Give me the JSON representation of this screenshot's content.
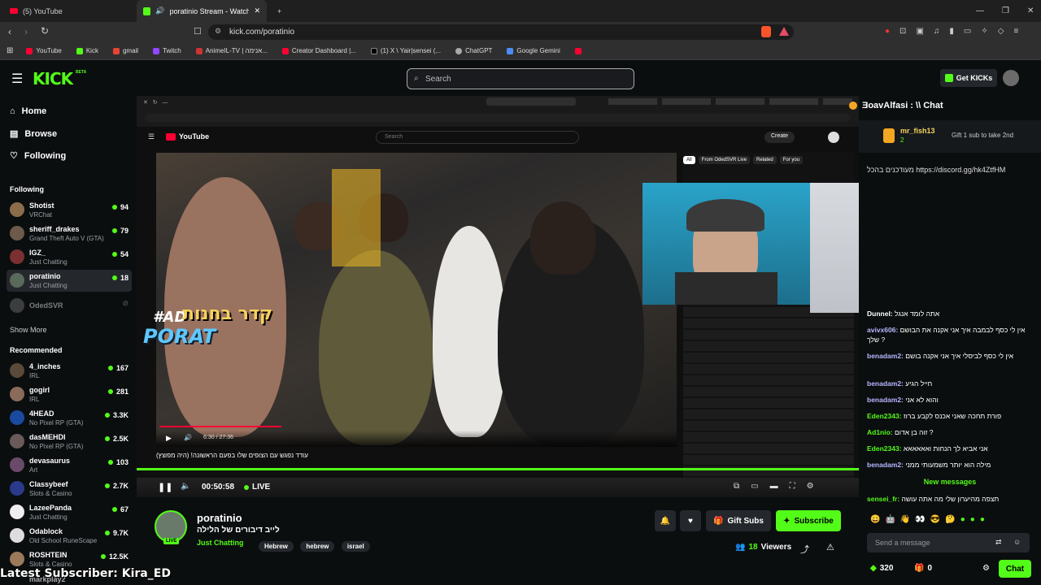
{
  "browser": {
    "tabs": [
      {
        "title": "(5) YouTube",
        "active": false
      },
      {
        "title": "poratinio Stream - Watch Live",
        "active": true
      }
    ],
    "new_tab": "+",
    "url": "kick.com/poratinio",
    "bookmarks": [
      "YouTube",
      "Kick",
      "gmail",
      "Twitch",
      "AnimeIL-TV | אנימה...",
      "Creator Dashboard |...",
      "(1) X \\ Yair|sensei (...",
      "ChatGPT",
      "Google Gemini"
    ]
  },
  "kick": {
    "logo": "KICK",
    "beta": "BETA",
    "search_placeholder": "Search",
    "get_kicks": "Get KICKs"
  },
  "sidebar": {
    "nav": [
      "Home",
      "Browse",
      "Following"
    ],
    "following_header": "Following",
    "following": [
      {
        "name": "Shotist",
        "game": "VRChat",
        "viewers": "94"
      },
      {
        "name": "sheriff_drakes",
        "game": "Grand Theft Auto V (GTA)",
        "viewers": "79"
      },
      {
        "name": "IGZ_",
        "game": "Just Chatting",
        "viewers": "54"
      },
      {
        "name": "poratinio",
        "game": "Just Chatting",
        "viewers": "18"
      },
      {
        "name": "OdedSVR",
        "game": "",
        "viewers": ""
      }
    ],
    "show_more": "Show More",
    "recommended_header": "Recommended",
    "recommended": [
      {
        "name": "4_inches",
        "game": "IRL",
        "viewers": "167"
      },
      {
        "name": "gogirl",
        "game": "IRL",
        "viewers": "281"
      },
      {
        "name": "4HEAD",
        "game": "No Pixel RP (GTA)",
        "viewers": "3.3K"
      },
      {
        "name": "dasMEHDI",
        "game": "No Pixel RP (GTA)",
        "viewers": "2.5K"
      },
      {
        "name": "devasaurus",
        "game": "Art",
        "viewers": "103"
      },
      {
        "name": "Classybeef",
        "game": "Slots & Casino",
        "viewers": "2.7K"
      },
      {
        "name": "LazeePanda",
        "game": "Just Chatting",
        "viewers": "67"
      },
      {
        "name": "Odablock",
        "game": "Old School RuneScape",
        "viewers": "9.7K"
      },
      {
        "name": "ROSHTEIN",
        "game": "Slots & Casino",
        "viewers": "12.5K"
      }
    ]
  },
  "stream": {
    "inner_search": "Search",
    "create": "Create",
    "overlay_ad": "#AD",
    "overlay_hebrew": "קדר בחנות",
    "overlay_porat": "PORAT",
    "video_time": "6:30 / 27:36",
    "video_title": "עודד נפגש עם הצופים שלו בפעם הראשונה! (היה מפוצץ)",
    "yt_chips": [
      "All",
      "From OdedSVR Live",
      "Related",
      "For you"
    ],
    "stream_time": "00:50:58",
    "live": "LIVE"
  },
  "channel": {
    "name": "poratinio",
    "title": "לייב דיבורים של הלילה",
    "category": "Just Chatting",
    "tags": [
      "Hebrew",
      "hebrew",
      "israel"
    ],
    "live_badge": "LIVE",
    "gift_subs": "Gift Subs",
    "subscribe": "Subscribe",
    "viewers": "18",
    "viewers_label": "Viewers"
  },
  "chat": {
    "header": "ƎoavAlfasi : \\\\ Chat",
    "pinned_user": "mr_fish13",
    "pinned_count": "2",
    "pinned_text": "Gift 1 sub to take 2nd",
    "discord": "מעודכנים בהכל https://discord.gg/hk4ZtfHM",
    "messages": [
      {
        "user": "Dunnel:",
        "text": "אתה לומד אנגל",
        "color": "#dddddd"
      },
      {
        "user": "avivx606:",
        "text": "אין לי כסף לבמבה איך אני אקנה את הבושם שלך ?",
        "color": "#b7b7ff"
      },
      {
        "user": "benadam2:",
        "text": "אין לי כסף לביסלי איך אני אקנה בושם",
        "color": "#b7b7ff"
      },
      {
        "user": "benadam2:",
        "text": "חייל הגיע",
        "color": "#b7b7ff"
      },
      {
        "user": "benadam2:",
        "text": "והוא לא אני",
        "color": "#b7b7ff"
      },
      {
        "user": "Eden2343:",
        "text": "פורת תחכה שאני אכנס לקבע ברוז",
        "color": "#53fc18"
      },
      {
        "user": "Ad1nio:",
        "text": "זוה בן אדום ?",
        "color": "#53fc18"
      },
      {
        "user": "Eden2343:",
        "text": "אני אביא לך הנחות ואאאאאא",
        "color": "#53fc18"
      },
      {
        "user": "benadam2:",
        "text": "מילה הוא יותר משמעותי ממני",
        "color": "#b7b7ff"
      }
    ],
    "new_messages": "New messages",
    "last_user": "sensei_fr:",
    "last_text": "תצפה מהיערון שלי מה אתה עושה",
    "input_placeholder": "Send a message",
    "kicks": "320",
    "subs": "0",
    "chat_button": "Chat"
  },
  "overlay_bottom": {
    "latest_subscriber": "Latest Subscriber: Kira_ED",
    "partial_name": "markplay2"
  },
  "colors": {
    "brand": "#53fc18",
    "bg": "#0b0e0f",
    "panel": "#24272c"
  }
}
